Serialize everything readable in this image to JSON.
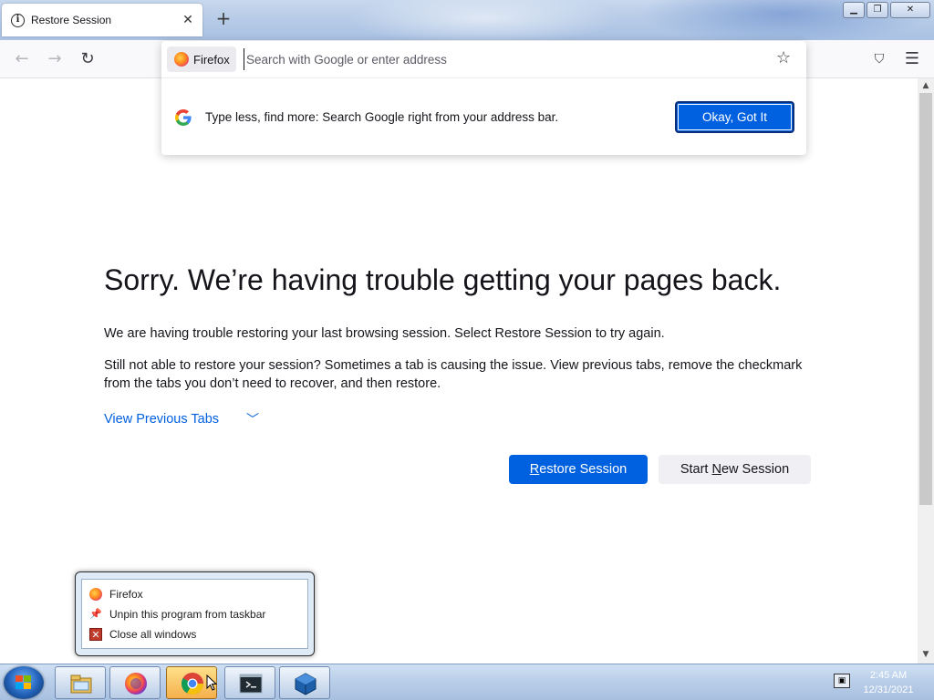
{
  "window": {
    "tab_title": "Restore Session",
    "tab_close": "✕",
    "new_tab": "+",
    "min_label": "▁",
    "max_label": "❐",
    "close_label": "✕"
  },
  "navbar": {
    "back_icon": "←",
    "forward_icon": "→",
    "reload_icon": "↻",
    "pocket_icon": "⛉",
    "menu_icon": "☰"
  },
  "urlbar": {
    "identity_label": "Firefox",
    "placeholder": "Search with Google or enter address",
    "star_icon": "☆",
    "google_glyph": "G",
    "tip_text": "Type less, find more: Search Google right from your address bar.",
    "okay_button": "Okay, Got It"
  },
  "content": {
    "heading": "Sorry. We’re having trouble getting your pages back.",
    "para1": "We are having trouble restoring your last browsing session. Select Restore Session to try again.",
    "para2": "Still not able to restore your session? Sometimes a tab is causing the issue. View previous tabs, remove the checkmark from the tabs you don’t need to recover, and then restore.",
    "view_previous": "View Previous Tabs",
    "chevron": "﹀",
    "restore_button_acc": "R",
    "restore_button_rest": "estore Session",
    "new_session_pre": "Start ",
    "new_session_acc": "N",
    "new_session_rest": "ew Session"
  },
  "jumplist": {
    "items": [
      {
        "label": "Firefox",
        "icon": "firefox-icon"
      },
      {
        "label": "Unpin this program from taskbar",
        "icon": "unpin-icon"
      },
      {
        "label": "Close all windows",
        "icon": "close-windows-icon"
      }
    ]
  },
  "taskbar": {
    "clock_time": "2:45 AM",
    "clock_date": "12/31/2021",
    "items": [
      "file-explorer-icon",
      "firefox-icon",
      "chrome-icon",
      "terminal-icon",
      "virtualbox-icon"
    ]
  },
  "colors": {
    "accent_blue": "#0061e0",
    "link_blue": "#0060df",
    "text": "#15141a"
  }
}
